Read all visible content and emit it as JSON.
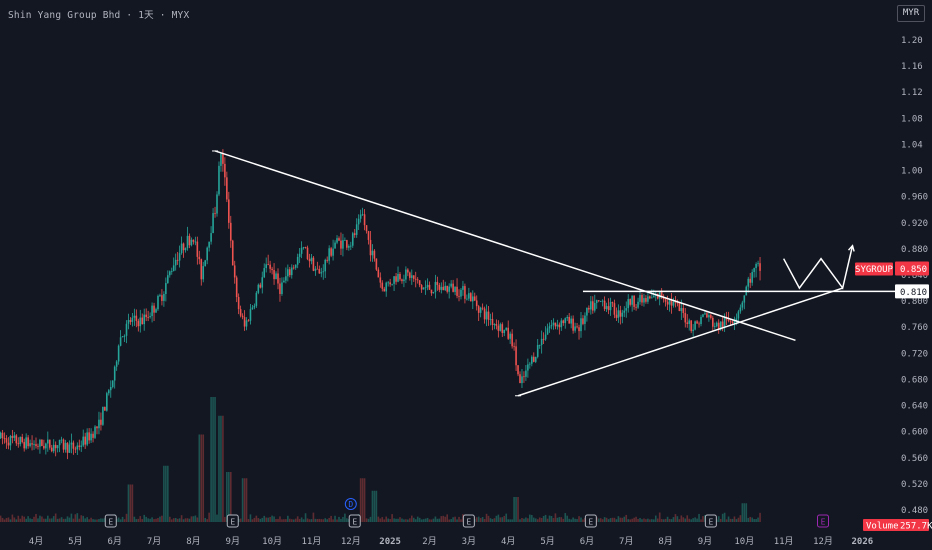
{
  "header": {
    "symbol_title": "Shin Yang Group Bhd · 1天 · MYX",
    "currency": "MYR"
  },
  "colors": {
    "background": "#131722",
    "up": "#26a69a",
    "down": "#ef5350",
    "drawing": "#ffffff",
    "tag": "#f23645"
  },
  "chart_data": {
    "type": "candlestick",
    "price_axis": {
      "ticks": [
        "1.20",
        "1.16",
        "1.12",
        "1.08",
        "1.04",
        "1.00",
        "0.960",
        "0.920",
        "0.880",
        "0.840",
        "0.800",
        "0.760",
        "0.720",
        "0.680",
        "0.640",
        "0.600",
        "0.560",
        "0.520",
        "0.480"
      ],
      "range": [
        0.47,
        1.235
      ]
    },
    "time_axis": {
      "ticks": [
        "4月",
        "5月",
        "6月",
        "7月",
        "8月",
        "9月",
        "10月",
        "11月",
        "12月",
        "2025",
        "2月",
        "3月",
        "4月",
        "5月",
        "6月",
        "7月",
        "8月",
        "9月",
        "10月",
        "11月",
        "12月",
        "2026"
      ],
      "positions": [
        0,
        1,
        2,
        3,
        4,
        5,
        6,
        7,
        8,
        9,
        10,
        11,
        12,
        13,
        14,
        15,
        16,
        17,
        18,
        19,
        20,
        21
      ]
    },
    "price_path": [
      [
        -0.9,
        0.59
      ],
      [
        0,
        0.58
      ],
      [
        0.5,
        0.58
      ],
      [
        1,
        0.575
      ],
      [
        1.3,
        0.59
      ],
      [
        1.6,
        0.61
      ],
      [
        1.8,
        0.65
      ],
      [
        2,
        0.69
      ],
      [
        2.1,
        0.74
      ],
      [
        2.4,
        0.77
      ],
      [
        2.7,
        0.77
      ],
      [
        3,
        0.79
      ],
      [
        3.2,
        0.81
      ],
      [
        3.5,
        0.86
      ],
      [
        3.8,
        0.89
      ],
      [
        4,
        0.9
      ],
      [
        4.2,
        0.84
      ],
      [
        4.4,
        0.9
      ],
      [
        4.55,
        0.94
      ],
      [
        4.7,
        1.03
      ],
      [
        4.85,
        0.96
      ],
      [
        5,
        0.86
      ],
      [
        5.1,
        0.8
      ],
      [
        5.3,
        0.76
      ],
      [
        5.6,
        0.81
      ],
      [
        5.9,
        0.86
      ],
      [
        6.2,
        0.82
      ],
      [
        6.5,
        0.85
      ],
      [
        6.8,
        0.88
      ],
      [
        7.2,
        0.84
      ],
      [
        7.6,
        0.89
      ],
      [
        8,
        0.89
      ],
      [
        8.3,
        0.93
      ],
      [
        8.5,
        0.88
      ],
      [
        8.8,
        0.82
      ],
      [
        9.2,
        0.84
      ],
      [
        9.5,
        0.84
      ],
      [
        9.8,
        0.82
      ],
      [
        10.2,
        0.82
      ],
      [
        10.6,
        0.82
      ],
      [
        11,
        0.81
      ],
      [
        11.4,
        0.78
      ],
      [
        11.8,
        0.76
      ],
      [
        12.1,
        0.74
      ],
      [
        12.3,
        0.67
      ],
      [
        12.6,
        0.71
      ],
      [
        13,
        0.76
      ],
      [
        13.4,
        0.77
      ],
      [
        13.8,
        0.76
      ],
      [
        14.1,
        0.79
      ],
      [
        14.4,
        0.8
      ],
      [
        14.8,
        0.78
      ],
      [
        15.1,
        0.8
      ],
      [
        15.5,
        0.8
      ],
      [
        15.9,
        0.81
      ],
      [
        16.3,
        0.79
      ],
      [
        16.7,
        0.76
      ],
      [
        17,
        0.78
      ],
      [
        17.3,
        0.76
      ],
      [
        17.6,
        0.77
      ],
      [
        17.8,
        0.78
      ],
      [
        18,
        0.81
      ],
      [
        18.1,
        0.83
      ],
      [
        18.3,
        0.85
      ],
      [
        18.4,
        0.85
      ]
    ],
    "volume_spikes": [
      [
        2.4,
        0.3
      ],
      [
        3.3,
        0.45
      ],
      [
        4.2,
        0.7
      ],
      [
        4.5,
        1.0
      ],
      [
        4.7,
        0.85
      ],
      [
        4.9,
        0.4
      ],
      [
        5.3,
        0.35
      ],
      [
        8.3,
        0.35
      ],
      [
        8.6,
        0.25
      ],
      [
        12.2,
        0.2
      ],
      [
        18.0,
        0.15
      ]
    ],
    "last_price": "0.850",
    "symbol_tag": "SYGROUP",
    "level_label": "0.810",
    "volume_label": "Volume",
    "volume_value": "257.7K",
    "drawings": {
      "descending_trendline": [
        [
          4.55,
          1.03
        ],
        [
          19.3,
          0.74
        ]
      ],
      "ascending_trendline": [
        [
          12.25,
          0.655
        ],
        [
          20.5,
          0.82
        ]
      ],
      "horizontal_level": [
        [
          13.9,
          0.815
        ],
        [
          22.0,
          0.815
        ]
      ],
      "projection_path": [
        [
          19.0,
          0.865
        ],
        [
          19.4,
          0.82
        ],
        [
          19.95,
          0.865
        ],
        [
          20.5,
          0.82
        ],
        [
          20.75,
          0.885
        ]
      ]
    },
    "event_markers": [
      {
        "pos": 1.9,
        "label": "E",
        "color": "#b2b5be"
      },
      {
        "pos": 5.0,
        "label": "E",
        "color": "#b2b5be"
      },
      {
        "pos": 8.1,
        "label": "E",
        "color": "#b2b5be"
      },
      {
        "pos": 8.0,
        "label": "D",
        "color": "#2962ff"
      },
      {
        "pos": 11.0,
        "label": "E",
        "color": "#b2b5be"
      },
      {
        "pos": 14.1,
        "label": "E",
        "color": "#b2b5be"
      },
      {
        "pos": 17.15,
        "label": "E",
        "color": "#b2b5be"
      },
      {
        "pos": 20.0,
        "label": "E",
        "color": "#9c27b0"
      }
    ]
  }
}
